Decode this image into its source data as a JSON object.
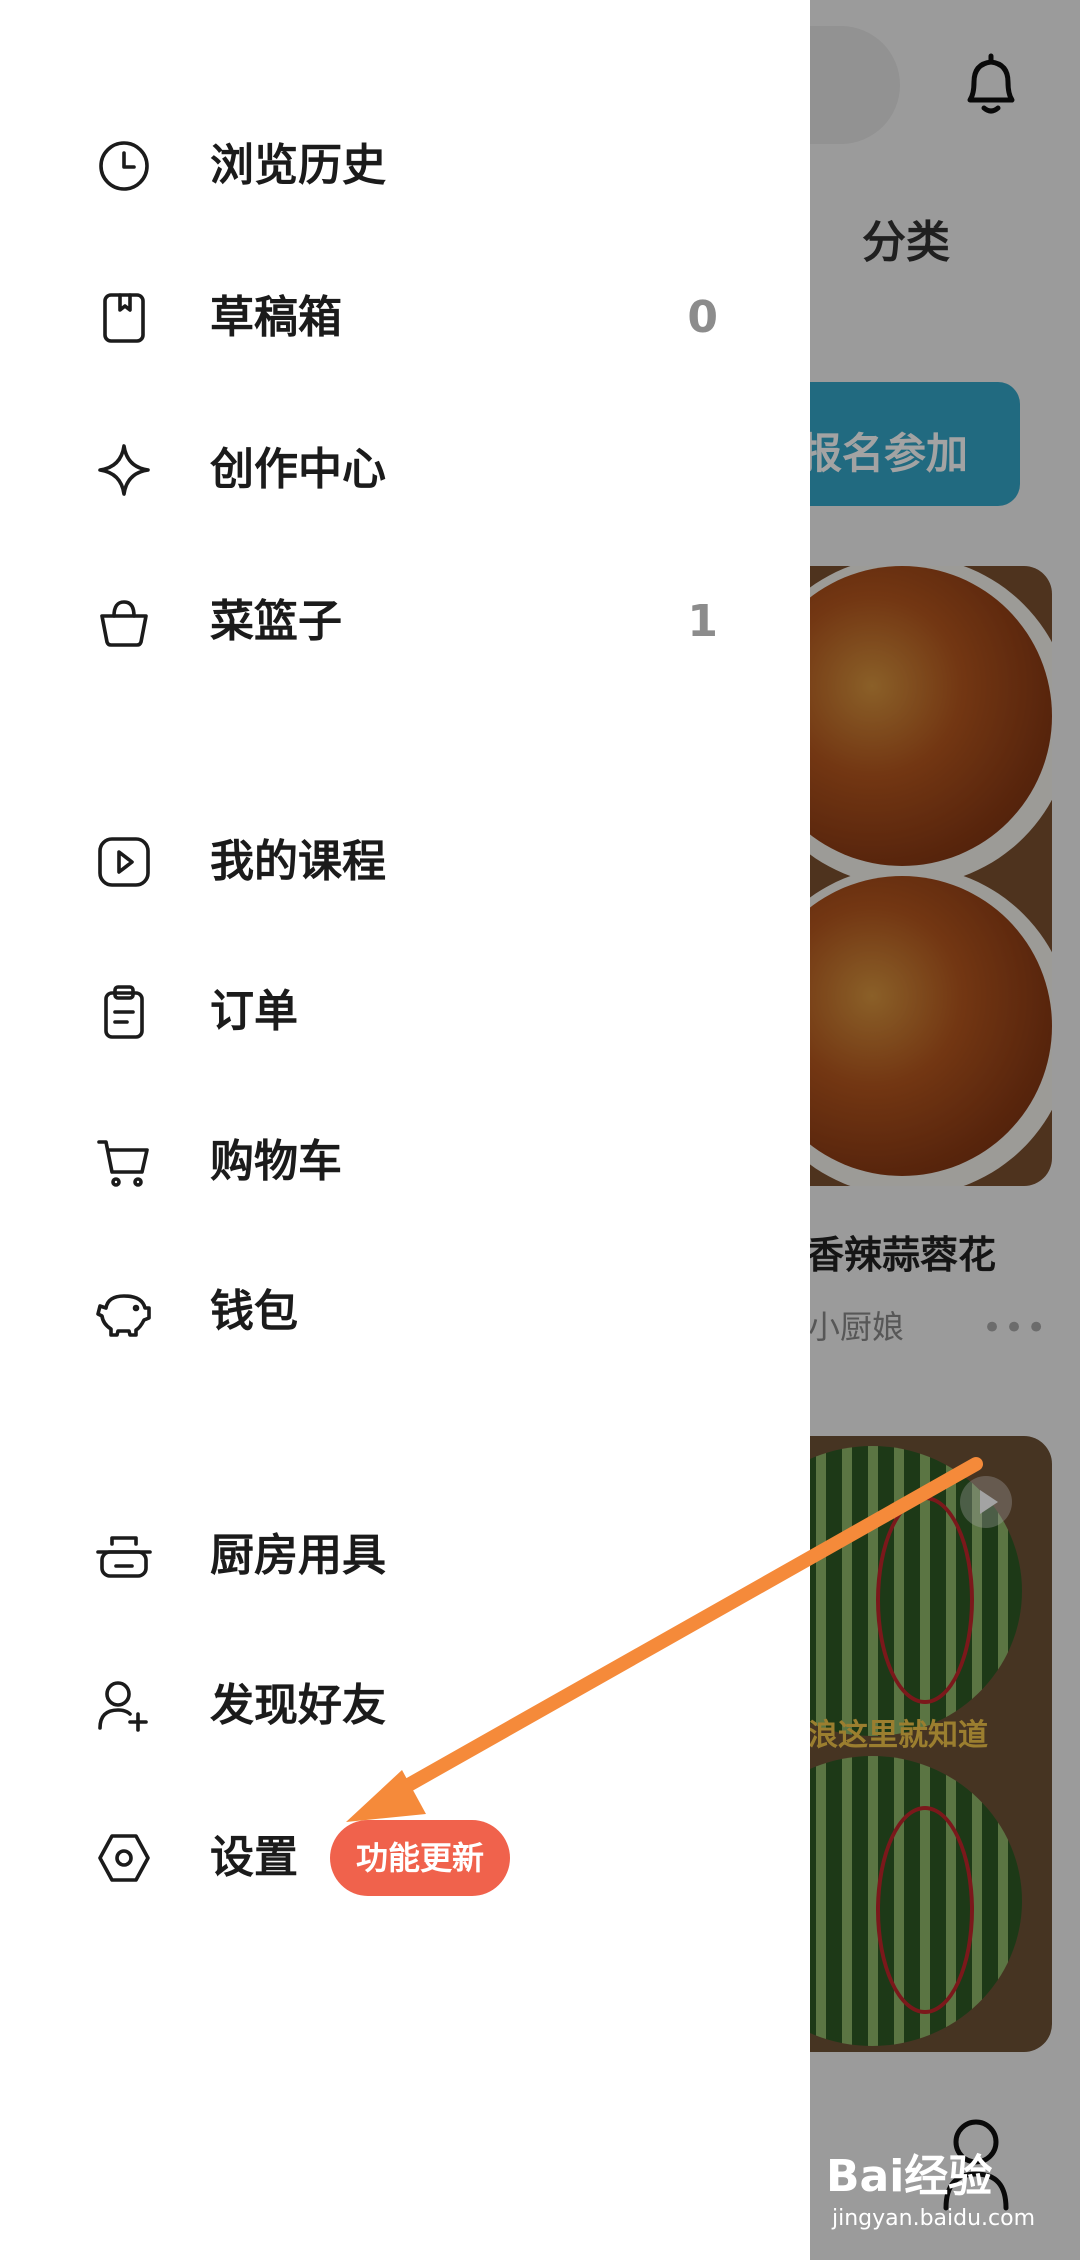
{
  "background": {
    "category_tab": "分类",
    "promo_label": "报名参加",
    "dish": {
      "title": "香辣蒜蓉花",
      "author": "小厨娘",
      "more": "•••"
    },
    "video_caption": "浪这里就知道",
    "watermark": "Bai经验",
    "watermark_sub": "jingyan.baidu.com"
  },
  "drawer": {
    "items": [
      {
        "label": "浏览历史",
        "icon": "clock-icon"
      },
      {
        "label": "草稿箱",
        "icon": "draft-box-icon",
        "count": "0"
      },
      {
        "label": "创作中心",
        "icon": "sparkle-icon"
      },
      {
        "label": "菜篮子",
        "icon": "basket-icon",
        "count": "1"
      },
      {
        "label": "我的课程",
        "icon": "play-square-icon"
      },
      {
        "label": "订单",
        "icon": "clipboard-icon"
      },
      {
        "label": "购物车",
        "icon": "cart-icon"
      },
      {
        "label": "钱包",
        "icon": "piggy-bank-icon"
      },
      {
        "label": "厨房用具",
        "icon": "cookware-icon"
      },
      {
        "label": "发现好友",
        "icon": "add-user-icon"
      },
      {
        "label": "设置",
        "icon": "settings-hex-icon",
        "badge": "功能更新"
      }
    ]
  },
  "colors": {
    "badge": "#f0624c",
    "annotation_arrow": "#f58a3a",
    "promo": "#35a6c8"
  }
}
